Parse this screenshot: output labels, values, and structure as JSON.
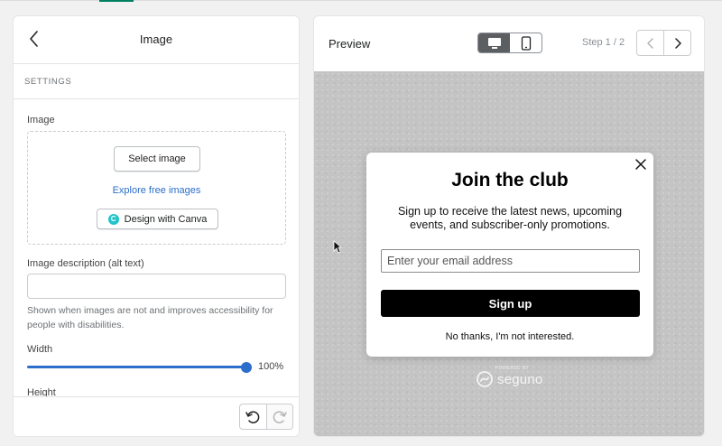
{
  "left_panel": {
    "title": "Image",
    "section_label": "SETTINGS",
    "image_field": {
      "label": "Image",
      "select_button": "Select image",
      "explore_link": "Explore free images",
      "canva_button": "Design with Canva"
    },
    "alt_text": {
      "label": "Image description (alt text)",
      "value": "",
      "help": "Shown when images are not and improves accessibility for people with disabilities."
    },
    "width": {
      "label": "Width",
      "value_label": "100%",
      "value": 1.0
    },
    "height": {
      "label": "Height"
    }
  },
  "preview": {
    "title": "Preview",
    "devices": [
      "desktop",
      "mobile"
    ],
    "active_device": "desktop",
    "step_label": "Step 1 / 2"
  },
  "popup": {
    "headline": "Join the club",
    "body": "Sign up to receive the latest news, upcoming events, and subscriber-only promotions.",
    "email_placeholder": "Enter your email address",
    "button_label": "Sign up",
    "decline_label": "No thanks, I'm not interested."
  },
  "branding": {
    "powered_by": "POWERED BY",
    "name": "seguno"
  },
  "colors": {
    "accent_blue": "#2c6ecb",
    "canvas_gray": "#c4c4c4",
    "button_black": "#000000",
    "active_toggle": "#5c5f62"
  }
}
